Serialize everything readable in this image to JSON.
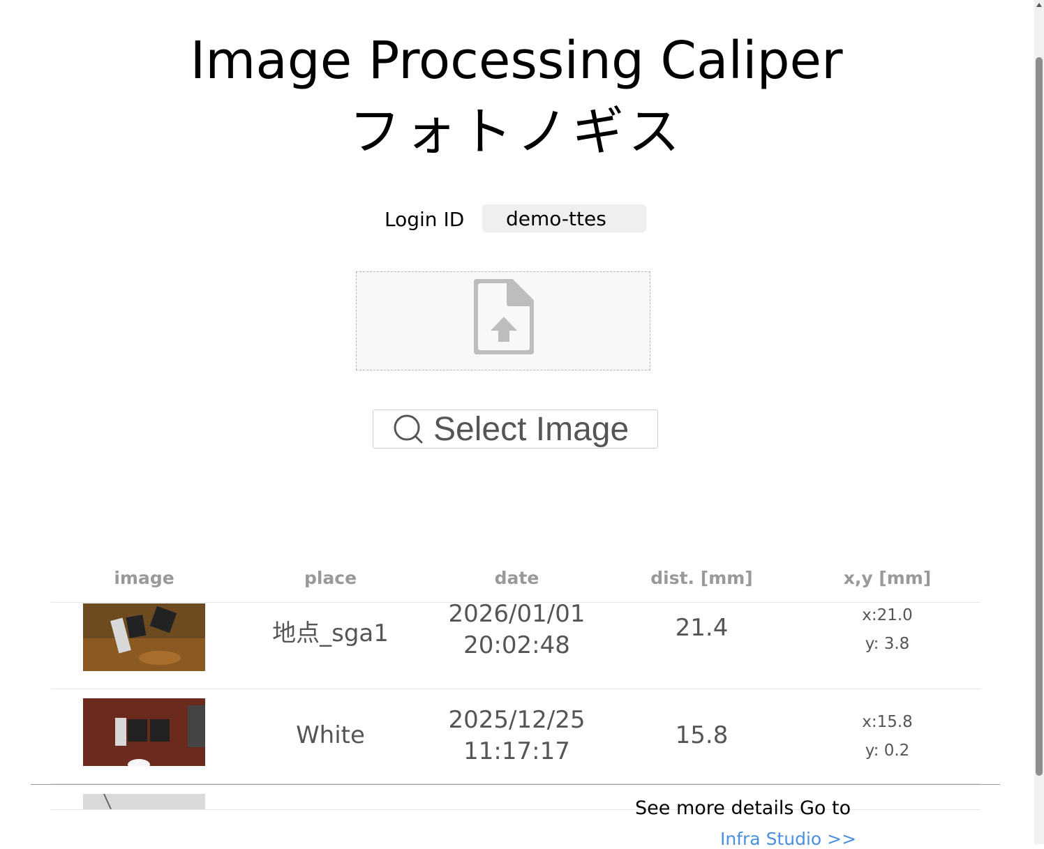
{
  "header": {
    "title_en": "Image Processing Caliper",
    "title_jp": "フォトノギス"
  },
  "login": {
    "label": "Login ID",
    "value": "demo-ttes"
  },
  "upload": {
    "icon": "file-upload-icon",
    "select_label": "Select Image",
    "select_icon": "search-icon"
  },
  "table": {
    "headers": [
      "image",
      "place",
      "date",
      "dist. [mm]",
      "x,y [mm]"
    ],
    "rows": [
      {
        "place": "地点_sga1",
        "date": "2026/01/01",
        "time": "20:02:48",
        "dist": "21.4",
        "x": "x:21.0",
        "y": "y: 3.8"
      },
      {
        "place": "White",
        "date": "2025/12/25",
        "time": "11:17:17",
        "dist": "15.8",
        "x": "x:15.8",
        "y": "y: 0.2"
      }
    ]
  },
  "footer": {
    "text": "See more details Go to",
    "link": "Infra Studio >>"
  }
}
